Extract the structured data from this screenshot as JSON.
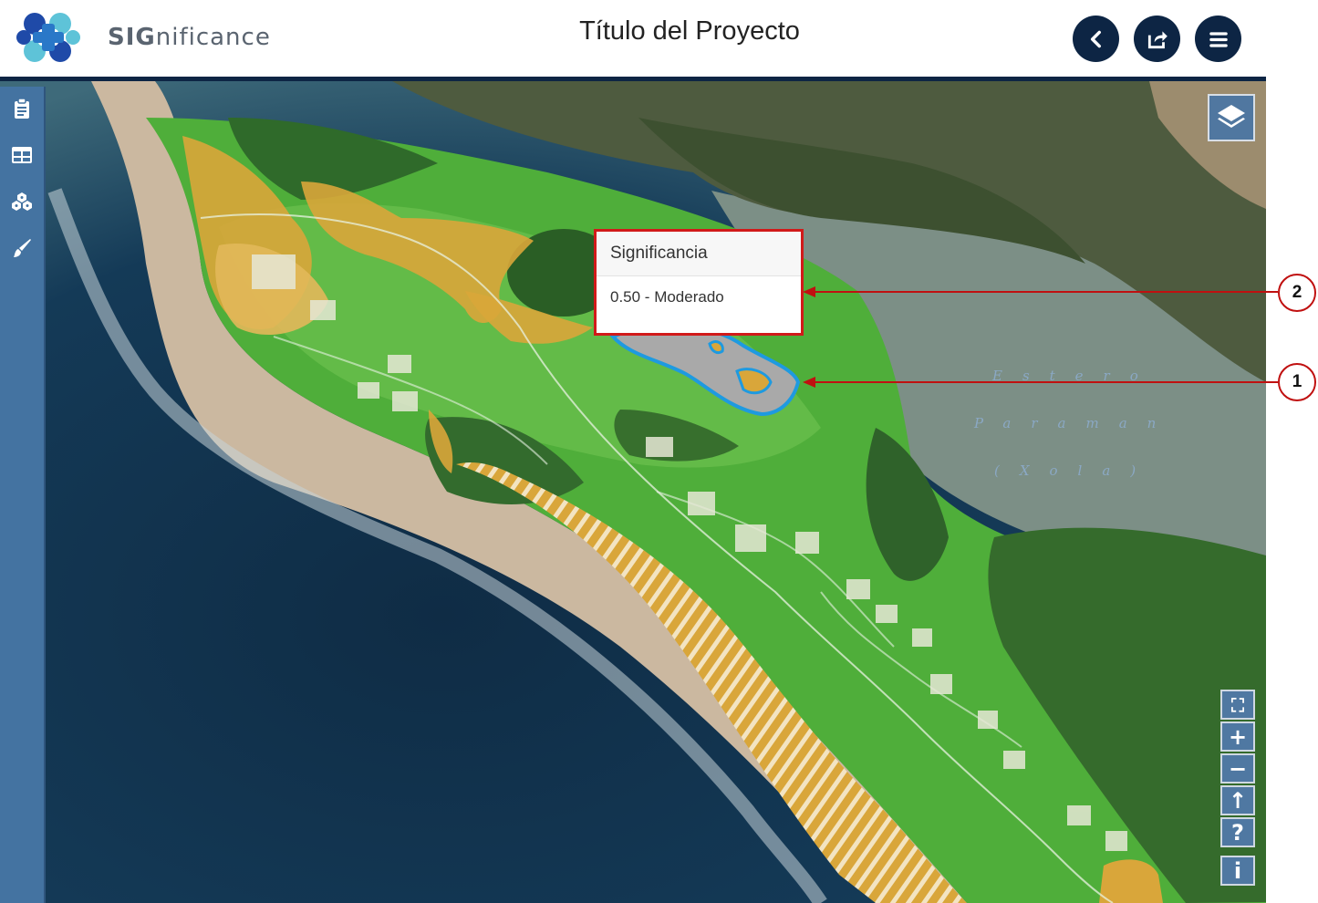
{
  "header": {
    "brand_prefix": "SIG",
    "brand_suffix": "nificance",
    "title": "Título del Proyecto",
    "buttons": [
      {
        "name": "back-button",
        "icon": "chevron-left-icon"
      },
      {
        "name": "share-button",
        "icon": "share-icon"
      },
      {
        "name": "menu-button",
        "icon": "hamburger-icon"
      }
    ]
  },
  "sidebar": {
    "items": [
      {
        "name": "clipboard",
        "icon": "clipboard-icon"
      },
      {
        "name": "table",
        "icon": "table-icon"
      },
      {
        "name": "layers-group",
        "icon": "cubes-icon"
      },
      {
        "name": "paint",
        "icon": "brush-icon"
      }
    ]
  },
  "popup": {
    "header": "Significancia",
    "value": "0.50 - Moderado"
  },
  "callouts": [
    "1",
    "2"
  ],
  "map_labels": {
    "line1": "Estero",
    "line2": "Paraman",
    "line3": "(Xola)"
  },
  "map_controls": {
    "fullscreen": "⛶",
    "zoom_in": "+",
    "zoom_out": "−",
    "north": "↑",
    "help": "?",
    "info": "i"
  },
  "colors": {
    "header_dark": "#0d2544",
    "sidebar": "#4473a1",
    "callout_red": "#c01010",
    "highlight_blue": "#1e9ae0",
    "zone_orange": "#d9a63a",
    "zone_green": "#4fae3a"
  }
}
